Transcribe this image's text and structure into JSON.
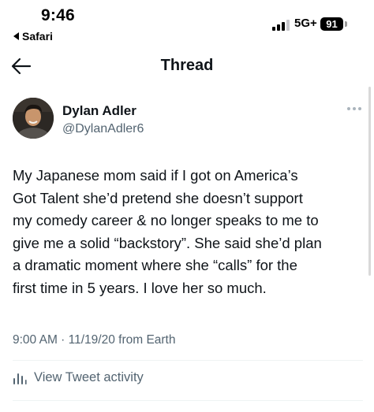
{
  "status_bar": {
    "time": "9:46",
    "back_app_label": "Safari",
    "network": "5G+",
    "battery": "91"
  },
  "nav": {
    "back_icon": "arrow-left-icon",
    "title": "Thread"
  },
  "tweet": {
    "author_name": "Dylan Adler",
    "author_handle": "@DylanAdler6",
    "more_icon": "more-horizontal-icon",
    "text": "My Japanese mom said if I got on America’s\nGot Talent she’d pretend she doesn’t support\nmy comedy career & no longer speaks to me to\ngive me a solid “backstory”. She said she’d plan\na dramatic moment where she “calls” for the\nfirst time in 5 years. I love her so much.",
    "meta": "9:00 AM · 11/19/20 from Earth"
  },
  "activity": {
    "icon": "bar-chart-icon",
    "label": "View Tweet activity"
  },
  "colors": {
    "text_primary": "#0f1419",
    "text_secondary": "#536471",
    "divider": "#eff3f4"
  }
}
